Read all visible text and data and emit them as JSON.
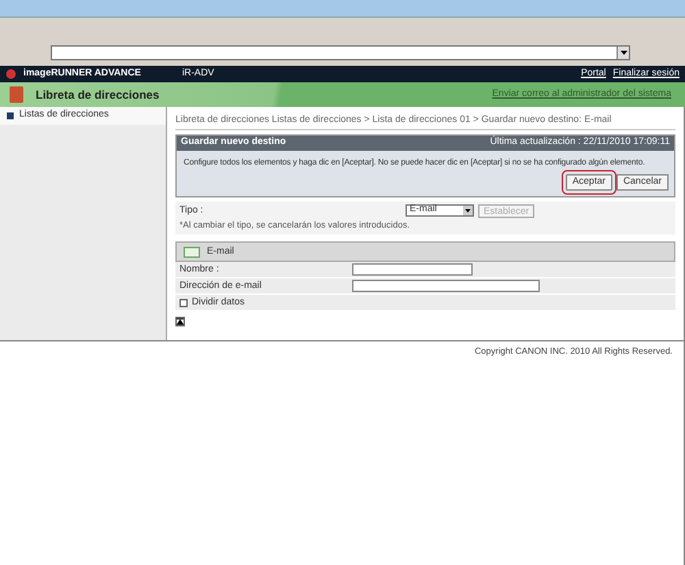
{
  "header": {
    "product": "imageRUNNER ADVANCE",
    "device": "iR-ADV",
    "links": [
      "Portal",
      "Finalizar sesión"
    ]
  },
  "title_bar": {
    "title": "Libreta de direcciones",
    "link": "Enviar correo al administrador del sistema"
  },
  "sidebar": {
    "items": [
      {
        "label": "Listas de direcciones",
        "selected": true
      }
    ]
  },
  "breadcrumb": "Libreta de direcciones  Listas de direcciones > Lista de direcciones 01 > Guardar nuevo destino: E-mail",
  "panel": {
    "title": "Guardar nuevo destino",
    "updated": "Última actualización : 22/11/2010 17:09:11",
    "message": "Configure todos los elementos y haga dic en [Aceptar]. No se puede hacer dic en [Aceptar] si no se ha configurado algún elemento.",
    "buttons": [
      {
        "label": "Aceptar",
        "highlighted": true
      },
      {
        "label": "Cancelar",
        "highlighted": false
      }
    ]
  },
  "type": {
    "label": "Tipo :",
    "note": "*Al cambiar el tipo, se cancelarán los valores introducidos.",
    "value": "E-mail",
    "button": {
      "label": "Establecer",
      "disabled": true
    }
  },
  "section": {
    "title": "E-mail"
  },
  "fields": [
    {
      "label": "Nombre :",
      "kind": "text",
      "wide": false
    },
    {
      "label": "Dirección de e-mail",
      "kind": "text",
      "wide": true
    },
    {
      "label": "Dividir datos",
      "kind": "checkbox",
      "checked": false
    }
  ],
  "footer": "Copyright CANON INC. 2010 All Rights Reserved."
}
